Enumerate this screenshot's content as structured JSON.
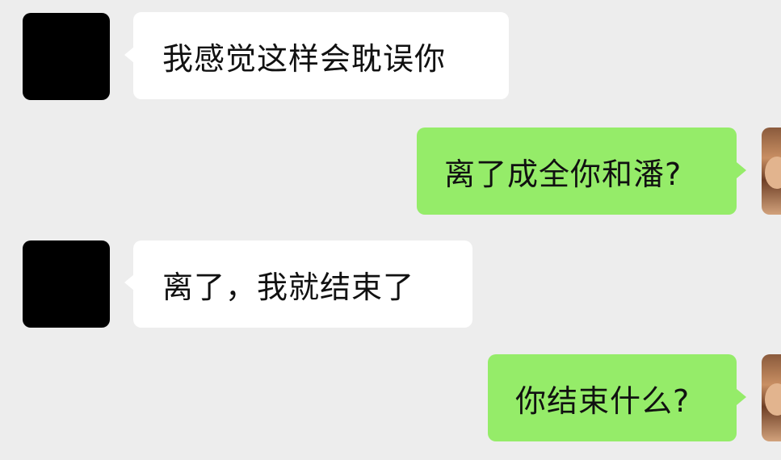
{
  "messages": [
    {
      "side": "left",
      "text": "我感觉这样会耽误你"
    },
    {
      "side": "right",
      "text": "离了成全你和潘?"
    },
    {
      "side": "left",
      "text": "离了，我就结束了"
    },
    {
      "side": "right",
      "text": "你结束什么?"
    }
  ],
  "colors": {
    "background": "#ededed",
    "incoming_bubble": "#ffffff",
    "outgoing_bubble": "#95ec69",
    "text": "#111111"
  }
}
